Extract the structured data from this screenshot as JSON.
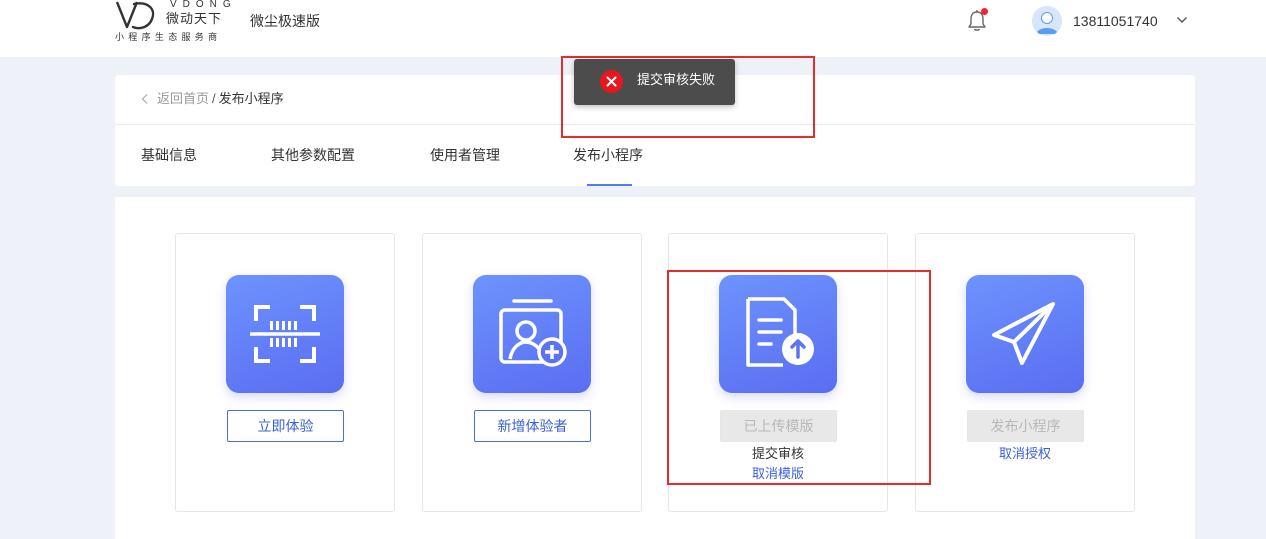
{
  "header": {
    "logo_en": "VDONG",
    "logo_cn": "微动天下",
    "logo_sub": "小程序生态服务商",
    "app_title": "微尘极速版",
    "username": "13811051740"
  },
  "breadcrumb": {
    "back": "返回首页",
    "separator": "/",
    "current": "发布小程序"
  },
  "tabs": [
    {
      "label": "基础信息",
      "active": false
    },
    {
      "label": "其他参数配置",
      "active": false
    },
    {
      "label": "使用者管理",
      "active": false
    },
    {
      "label": "发布小程序",
      "active": true
    }
  ],
  "cards": [
    {
      "icon": "scan-barcode-icon",
      "button": "立即体验",
      "button_state": "enabled"
    },
    {
      "icon": "add-tester-icon",
      "button": "新增体验者",
      "button_state": "enabled"
    },
    {
      "icon": "document-upload-icon",
      "button": "已上传模版",
      "button_state": "disabled",
      "status_text": "提交审核",
      "link": "取消模版"
    },
    {
      "icon": "paper-plane-icon",
      "button": "发布小程序",
      "button_state": "disabled",
      "link": "取消授权"
    }
  ],
  "toast": {
    "message": "提交审核失败",
    "icon": "error-circle-icon"
  },
  "colors": {
    "accent": "#4e7bf6",
    "link": "#3a5fd9",
    "highlight": "#e82b2b",
    "error": "#e8161f",
    "notification_dot": "#f5222d"
  }
}
